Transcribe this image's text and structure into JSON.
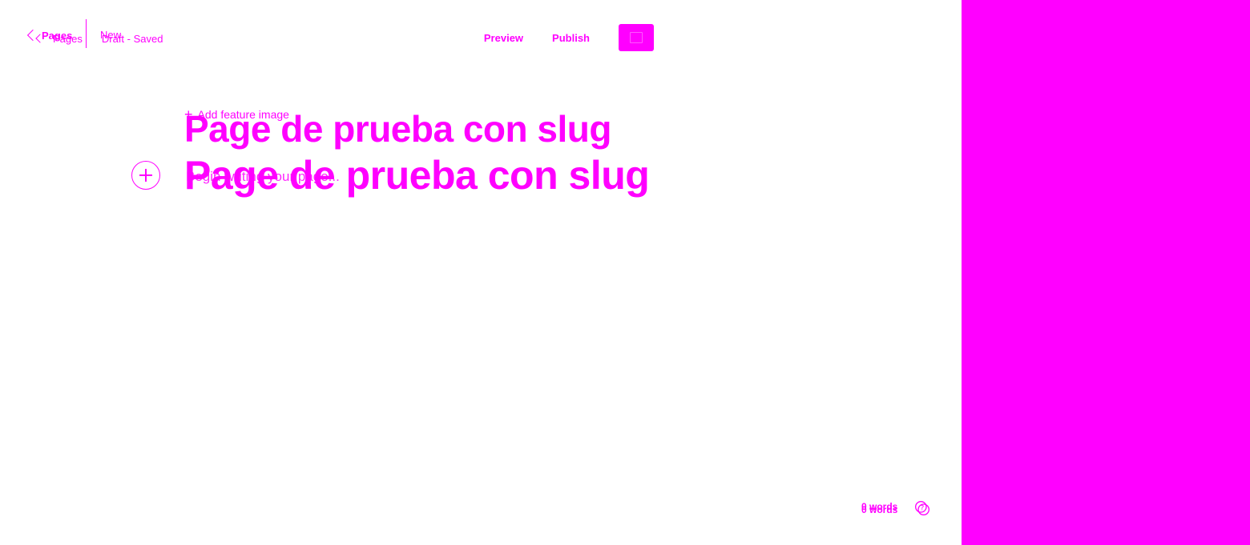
{
  "header": {
    "back_label": "Pages",
    "back_label_ghost": "Pages",
    "new_label": "New",
    "status": "Draft - Saved",
    "preview_label": "Preview",
    "publish_label": "Publish"
  },
  "editor": {
    "feature_image_label": "Add feature image",
    "title": "Page de prueba con slug",
    "title_ghost": "Page de prueba con slug",
    "body_placeholder": "Begin writing your page..."
  },
  "footer": {
    "word_count": "0 words",
    "word_count_ghost": "0 words"
  },
  "colors": {
    "accent": "#ff00ff",
    "background": "#ffffff"
  },
  "icons": {
    "back": "chevron-left-icon",
    "settings_toggle": "sidebar-toggle-icon",
    "add_card": "plus-circle-icon",
    "help": "help-icon"
  }
}
